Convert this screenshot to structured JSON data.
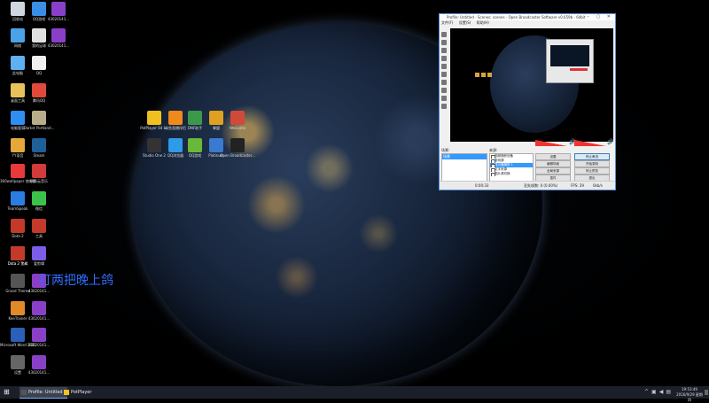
{
  "desktop": {
    "overlay_text": "打两把晚上鸽",
    "icons": [
      {
        "label": "回收站",
        "icon": "recycle-bin-icon",
        "color": "#cfd6e0"
      },
      {
        "label": "QQ游戏",
        "icon": "qq-game-icon",
        "color": "#3a8ee6"
      },
      {
        "label": "43020141...",
        "icon": "media-file-icon",
        "color": "#8a3fc7"
      },
      {
        "label": "网络",
        "icon": "network-icon",
        "color": "#4aa3e8"
      },
      {
        "label": "我的足球",
        "icon": "football-icon",
        "color": "#e0e0e0"
      },
      {
        "label": "43020141...",
        "icon": "media-file-icon",
        "color": "#8a3fc7"
      },
      {
        "label": "此电脑",
        "icon": "computer-icon",
        "color": "#5fb0f0"
      },
      {
        "label": "QQ",
        "icon": "qq-icon",
        "color": "#f0f0f0"
      },
      {
        "label": "桌面工具",
        "icon": "folder-icon",
        "color": "#e8c15a"
      },
      {
        "label": "腾讯QQ",
        "icon": "qq-penguin-icon",
        "color": "#e04a3a"
      },
      {
        "label": "电脑管家",
        "icon": "pc-manager-icon",
        "color": "#2f8ef2"
      },
      {
        "label": "Darkst Portland...",
        "icon": "game-icon",
        "color": "#b7ad8a"
      },
      {
        "label": "YY语音",
        "icon": "yy-icon",
        "color": "#e4a93a"
      },
      {
        "label": "Steam",
        "icon": "steam-icon",
        "color": "#1f5f99"
      },
      {
        "label": "360wallpaper 他的壁纸",
        "icon": "wallpaper-icon",
        "color": "#e83a3a"
      },
      {
        "label": "网易云音乐",
        "icon": "netease-music-icon",
        "color": "#d33a3a"
      },
      {
        "label": "TeamSpeak",
        "icon": "teamspeak-icon",
        "color": "#2a7de1"
      },
      {
        "label": "微信",
        "icon": "wechat-icon",
        "color": "#3cc24a"
      },
      {
        "label": "Dota 2",
        "icon": "dota2-icon",
        "color": "#c33a2a"
      },
      {
        "label": "Dota 2 Test",
        "icon": "dota2-test-icon",
        "color": "#eeeeee"
      },
      {
        "label": "工具",
        "icon": "tool-icon",
        "color": "#c33a2a"
      },
      {
        "label": "Dota 2 工具",
        "icon": "dota2-tool-icon",
        "color": "#c33a2a"
      },
      {
        "label": "爱剪辑",
        "icon": "video-editor-icon",
        "color": "#7b5de8"
      },
      {
        "label": "Grand Theme",
        "icon": "grand-theme-icon",
        "color": "#555555"
      },
      {
        "label": "43020141...",
        "icon": "media-file-icon",
        "color": "#8a3fc7"
      },
      {
        "label": "KeeTrainer",
        "icon": "trainer-icon",
        "color": "#e08a2a"
      },
      {
        "label": "43020141...",
        "icon": "media-file-icon",
        "color": "#8a3fc7"
      },
      {
        "label": "Microsoft Word 2010",
        "icon": "word-icon",
        "color": "#2b5fb8"
      },
      {
        "label": "43020141...",
        "icon": "media-file-icon",
        "color": "#8a3fc7"
      },
      {
        "label": "设置",
        "icon": "settings-icon",
        "color": "#666666"
      },
      {
        "label": "43020141...",
        "icon": "media-file-icon",
        "color": "#8a3fc7"
      },
      {
        "label": "PotPlayer 64 bit",
        "icon": "potplayer-icon",
        "color": "#f0c020"
      },
      {
        "label": "斗鱼直播伴侣",
        "icon": "douyu-icon",
        "color": "#f08a1a"
      },
      {
        "label": "DNF助手",
        "icon": "dnf-icon",
        "color": "#3a9a4a"
      },
      {
        "label": "掌盟",
        "icon": "lol-icon",
        "color": "#e0a020"
      },
      {
        "label": "WeGame",
        "icon": "wegame-icon",
        "color": "#d04a3a"
      },
      {
        "label": "Studio One 2",
        "icon": "studio-one-icon",
        "color": "#333333"
      },
      {
        "label": "QQ浏览器",
        "icon": "qq-browser-icon",
        "color": "#2f9ae8"
      },
      {
        "label": "QQ游戏",
        "icon": "qq-game-icon",
        "color": "#6ab83a"
      },
      {
        "label": "Platinum",
        "icon": "platinum-icon",
        "color": "#3a7ad0"
      },
      {
        "label": "Open Broadcaster...",
        "icon": "obs-icon",
        "color": "#222222"
      }
    ]
  },
  "obs": {
    "title": "Profile: Untitled - Scenes: scenes - Open Broadcaster Software v0.659b - 64bit",
    "menu": [
      "文件(F)",
      "设置(S)",
      "帮助(H)"
    ],
    "scenes_label": "场景:",
    "scene_item": "场景",
    "sources_label": "来源:",
    "sources": [
      "视频捕获设备",
      "游戏源",
      "显示器捕获 1",
      "文字来源",
      "图片源切换"
    ],
    "buttons": [
      "设置",
      "停止串流",
      "编辑场景",
      "开始录制",
      "全局来源",
      "停止预览",
      "插件",
      "退出"
    ],
    "status": {
      "time": "0:00:33",
      "dropped": "丢失帧数: 0 (0.00%)",
      "fps": "FPS: 29",
      "bitrate": "0kb/s"
    }
  },
  "taskbar": {
    "tasks": [
      {
        "label": "Profile: Untitled -...",
        "icon": "obs-icon",
        "color": "#555555"
      },
      {
        "label": "PotPlayer",
        "icon": "potplayer-icon",
        "color": "#f0c020"
      }
    ],
    "time": "19:53:49",
    "date": "2016/9/29 星期四",
    "tray_icons": [
      "chevron-up-icon",
      "network-icon",
      "volume-icon",
      "keyboard-icon"
    ]
  }
}
